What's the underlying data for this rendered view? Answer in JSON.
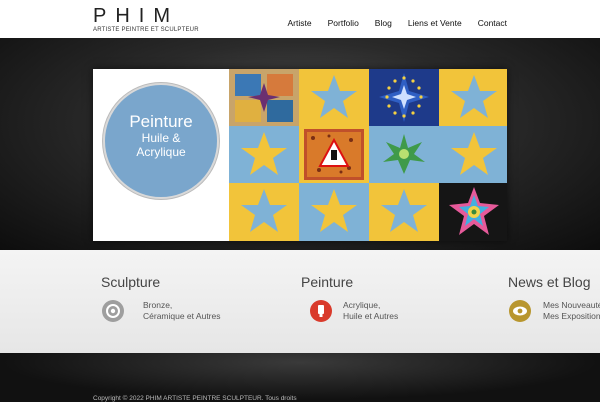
{
  "header": {
    "logo_title": "PHIM",
    "logo_tagline": "ARTISTE PEINTRE ET SCULPTEUR",
    "nav": [
      {
        "label": "Artiste"
      },
      {
        "label": "Portfolio"
      },
      {
        "label": "Blog"
      },
      {
        "label": "Liens et Vente"
      },
      {
        "label": "Contact"
      }
    ]
  },
  "hero": {
    "badge_line1": "Peinture",
    "badge_line2": "Huile &",
    "badge_line3": "Acrylique"
  },
  "services": [
    {
      "title": "Sculpture",
      "line1": "Bronze,",
      "line2": "Céramique et Autres",
      "icon": "target-icon",
      "color": "#9e9e9e"
    },
    {
      "title": "Peinture",
      "line1": "Acrylique,",
      "line2": "Huile et Autres",
      "icon": "paint-tube-icon",
      "color": "#d93a2b"
    },
    {
      "title": "News et Blog",
      "line1": "Mes Nouveautés",
      "line2": "Mes Expositions",
      "icon": "eye-icon",
      "color": "#b8962e"
    }
  ],
  "footer": {
    "copyright": "Copyright © 2022 PHIM ARTISTE PEINTRE SCULPTEUR. Tous droits"
  },
  "colors": {
    "badge_blue": "#7aa6cc",
    "tile_yellow": "#f2c43a",
    "tile_blue": "#7fb2d6"
  }
}
